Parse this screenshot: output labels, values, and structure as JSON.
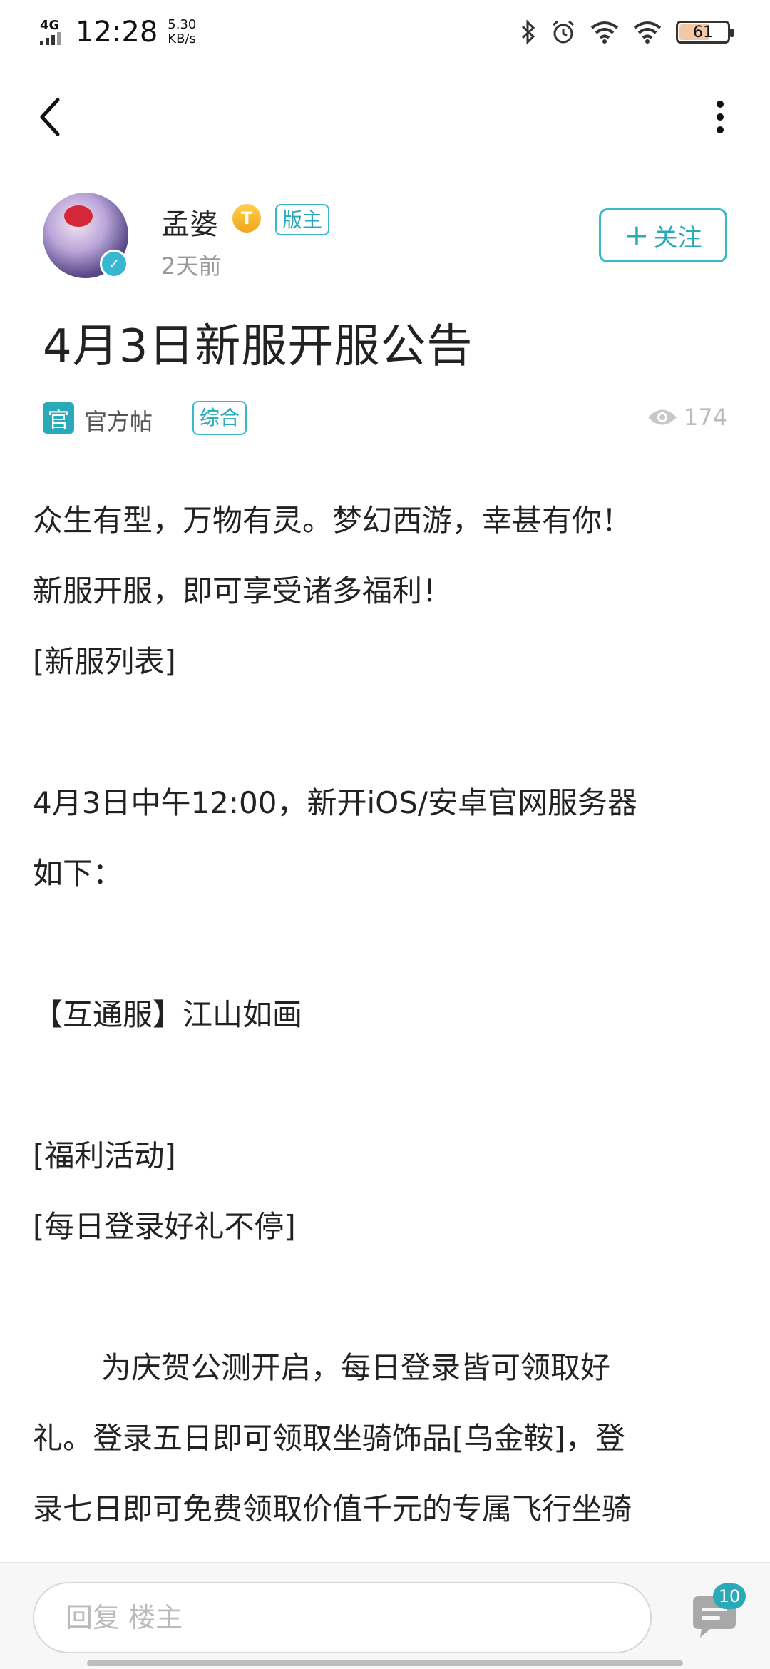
{
  "status_bar": {
    "network": "4G",
    "time": "12:28",
    "speed": "5.30 KB/s",
    "battery": "61"
  },
  "author": {
    "name": "孟婆",
    "level_badge": "T",
    "role": "版主",
    "time": "2天前",
    "follow_label": "关注"
  },
  "post": {
    "title": "4月3日新服开服公告",
    "official_icon": "官",
    "official_label": "官方帖",
    "category": "综合",
    "views": "174"
  },
  "content": {
    "lines": [
      "众生有型，万物有灵。梦幻西游，幸甚有你！",
      "新服开服，即可享受诸多福利！",
      "[新服列表]",
      "",
      "4月3日中午12:00，新开iOS/安卓官网服务器",
      "如下：",
      "",
      "【互通服】江山如画",
      "",
      "[福利活动]",
      "[每日登录好礼不停]",
      "",
      "为庆贺公测开启，每日登录皆可领取好",
      "礼。登录五日即可领取坐骑饰品[乌金鞍]，登",
      "录七日即可免费领取价值千元的专属飞行坐骑"
    ]
  },
  "bottom_bar": {
    "reply_placeholder": "回复 楼主",
    "comment_count": "10"
  },
  "colors": {
    "accent": "#2aa9b8",
    "text": "#222222",
    "muted": "#999999"
  }
}
